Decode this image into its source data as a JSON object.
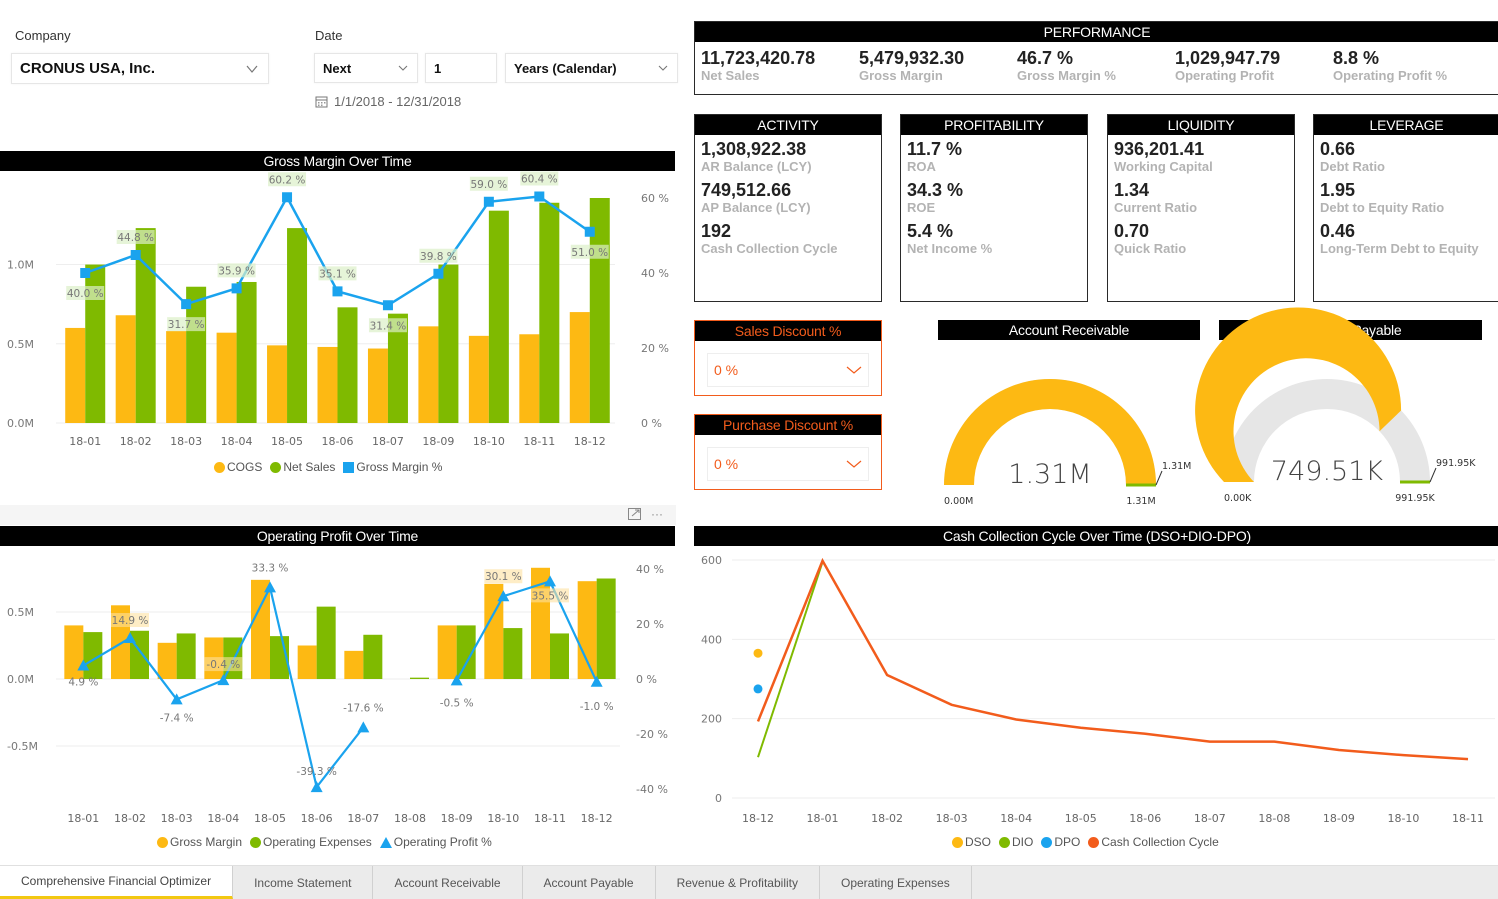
{
  "filters": {
    "company_label": "Company",
    "company_value": "CRONUS USA, Inc.",
    "date_label": "Date",
    "date_relative": "Next",
    "date_count": "1",
    "date_unit": "Years (Calendar)",
    "date_range": "1/1/2018 - 12/31/2018"
  },
  "performance": {
    "title": "PERFORMANCE",
    "items": [
      {
        "value": "11,723,420.78",
        "label": "Net Sales"
      },
      {
        "value": "5,479,932.30",
        "label": "Gross Margin"
      },
      {
        "value": "46.7 %",
        "label": "Gross Margin %"
      },
      {
        "value": "1,029,947.79",
        "label": "Operating Profit"
      },
      {
        "value": "8.8 %",
        "label": "Operating Profit %"
      }
    ]
  },
  "cards": [
    {
      "title": "ACTIVITY",
      "items": [
        {
          "value": "1,308,922.38",
          "label": "AR Balance (LCY)"
        },
        {
          "value": "749,512.66",
          "label": "AP Balance (LCY)"
        },
        {
          "value": "192",
          "label": "Cash Collection Cycle"
        }
      ]
    },
    {
      "title": "PROFITABILITY",
      "items": [
        {
          "value": "11.7 %",
          "label": "ROA"
        },
        {
          "value": "34.3 %",
          "label": "ROE"
        },
        {
          "value": "5.4 %",
          "label": "Net Income %"
        }
      ]
    },
    {
      "title": "LIQUIDITY",
      "items": [
        {
          "value": "936,201.41",
          "label": "Working Capital"
        },
        {
          "value": "1.34",
          "label": "Current Ratio"
        },
        {
          "value": "0.70",
          "label": "Quick Ratio"
        }
      ]
    },
    {
      "title": "LEVERAGE",
      "items": [
        {
          "value": "0.66",
          "label": "Debt Ratio"
        },
        {
          "value": "1.95",
          "label": "Debt to Equity Ratio"
        },
        {
          "value": "0.46",
          "label": "Long-Term Debt to Equity"
        }
      ]
    }
  ],
  "discounts": {
    "sales_title": "Sales Discount %",
    "sales_value": "0 %",
    "purchase_title": "Purchase Discount %",
    "purchase_value": "0 %"
  },
  "gauges": [
    {
      "title": "Account Receivable",
      "value_label": "1.31M",
      "min_label": "0.00M",
      "max_label": "1.31M",
      "target_label": "1.31M",
      "fraction": 1.0,
      "target_fraction": 1.0
    },
    {
      "title": "Account Payable",
      "value_label": "749.51K",
      "min_label": "0.00K",
      "max_label": "991.95K",
      "target_label": "991.95K",
      "fraction": 0.7556,
      "target_fraction": 1.0
    }
  ],
  "colors": {
    "yellow": "#fdb913",
    "green": "#7fba00",
    "blue": "#1aa3ee",
    "orange": "#f25c1c",
    "gray_track": "#e6e6e6"
  },
  "tabs": [
    {
      "label": "Comprehensive Financial Optimizer",
      "active": true
    },
    {
      "label": "Income Statement",
      "active": false
    },
    {
      "label": "Account Receivable",
      "active": false
    },
    {
      "label": "Account Payable",
      "active": false
    },
    {
      "label": "Revenue & Profitability",
      "active": false
    },
    {
      "label": "Operating Expenses",
      "active": false
    }
  ],
  "chart_data": [
    {
      "id": "gross-margin-over-time",
      "type": "bar",
      "title": "Gross Margin Over Time",
      "categories": [
        "18-01",
        "18-02",
        "18-03",
        "18-04",
        "18-05",
        "18-06",
        "18-07",
        "18-09",
        "18-10",
        "18-11",
        "18-12"
      ],
      "series": [
        {
          "name": "COGS",
          "kind": "bar",
          "axis": "left",
          "values": [
            0.6,
            0.68,
            0.58,
            0.57,
            0.49,
            0.48,
            0.47,
            0.61,
            0.55,
            0.56,
            0.7
          ]
        },
        {
          "name": "Net Sales",
          "kind": "bar",
          "axis": "left",
          "values": [
            1.0,
            1.23,
            0.86,
            0.89,
            1.23,
            0.73,
            0.69,
            1.0,
            1.34,
            1.39,
            1.42
          ]
        },
        {
          "name": "Gross Margin %",
          "kind": "line",
          "axis": "right",
          "values": [
            40.0,
            44.8,
            31.7,
            35.9,
            60.2,
            35.1,
            31.4,
            39.8,
            59.0,
            60.4,
            51.0
          ]
        }
      ],
      "data_labels": [
        "40.0 %",
        "44.8 %",
        "31.7 %",
        "35.9 %",
        "60.2 %",
        "35.1 %",
        "31.4 %",
        "39.8 %",
        "59.0 %",
        "60.4 %",
        "51.0 %"
      ],
      "y_left": {
        "ticks": [
          "0.0M",
          "0.5M",
          "1.0M"
        ],
        "range": [
          0,
          1.5
        ]
      },
      "y_right": {
        "ticks": [
          "0 %",
          "20 %",
          "40 %",
          "60 %"
        ],
        "range": [
          0,
          60
        ]
      },
      "legend": "bottom-center"
    },
    {
      "id": "operating-profit-over-time",
      "type": "bar",
      "title": "Operating Profit Over Time",
      "categories": [
        "18-01",
        "18-02",
        "18-03",
        "18-04",
        "18-05",
        "18-06",
        "18-07",
        "18-08",
        "18-09",
        "18-10",
        "18-11",
        "18-12"
      ],
      "series": [
        {
          "name": "Gross Margin",
          "kind": "bar",
          "axis": "left",
          "values": [
            0.4,
            0.55,
            0.27,
            0.31,
            0.74,
            0.25,
            0.21,
            0.0,
            0.4,
            0.71,
            0.83,
            0.73
          ]
        },
        {
          "name": "Operating Expenses",
          "kind": "bar",
          "axis": "left",
          "values": [
            0.35,
            0.36,
            0.34,
            0.31,
            0.32,
            0.54,
            0.33,
            0.01,
            0.4,
            0.38,
            0.34,
            0.75
          ]
        },
        {
          "name": "Operating Profit %",
          "kind": "line",
          "axis": "right",
          "values": [
            4.9,
            14.9,
            -7.4,
            -0.4,
            33.3,
            -39.3,
            -17.6,
            null,
            -0.5,
            30.1,
            35.5,
            -1.0
          ]
        }
      ],
      "data_labels": [
        "4.9 %",
        "14.9 %",
        "-7.4 %",
        "-0.4 %",
        "33.3 %",
        "-39.3 %",
        "-17.6 %",
        "",
        "-0.5 %",
        "30.1 %",
        "35.5 %",
        "-1.0 %"
      ],
      "y_left": {
        "ticks": [
          "-0.5M",
          "0.0M",
          "0.5M"
        ],
        "range": [
          -0.8,
          0.9
        ]
      },
      "y_right": {
        "ticks": [
          "-40 %",
          "-20 %",
          "0 %",
          "20 %",
          "40 %"
        ],
        "range": [
          -40,
          40
        ]
      },
      "legend": "bottom-center"
    },
    {
      "id": "cash-collection-cycle-over-time",
      "type": "line",
      "title": "Cash Collection Cycle Over Time (DSO+DIO-DPO)",
      "categories": [
        "18-12",
        "18-01",
        "18-02",
        "18-03",
        "18-04",
        "18-05",
        "18-06",
        "18-07",
        "18-08",
        "18-09",
        "18-10",
        "18-11"
      ],
      "series": [
        {
          "name": "DSO",
          "values": [
            365,
            null,
            null,
            null,
            null,
            null,
            null,
            null,
            null,
            null,
            null,
            null
          ]
        },
        {
          "name": "DIO",
          "values": [
            103,
            595,
            null,
            null,
            null,
            null,
            null,
            null,
            null,
            null,
            null,
            null
          ]
        },
        {
          "name": "DPO",
          "values": [
            275,
            null,
            null,
            null,
            null,
            null,
            null,
            null,
            null,
            null,
            null,
            null
          ]
        },
        {
          "name": "Cash Collection Cycle",
          "values": [
            193,
            598,
            310,
            235,
            198,
            177,
            162,
            142,
            142,
            121,
            108,
            98
          ]
        }
      ],
      "y": {
        "ticks": [
          "0",
          "200",
          "400",
          "600"
        ],
        "range": [
          0,
          600
        ]
      },
      "legend": "bottom-center"
    }
  ]
}
